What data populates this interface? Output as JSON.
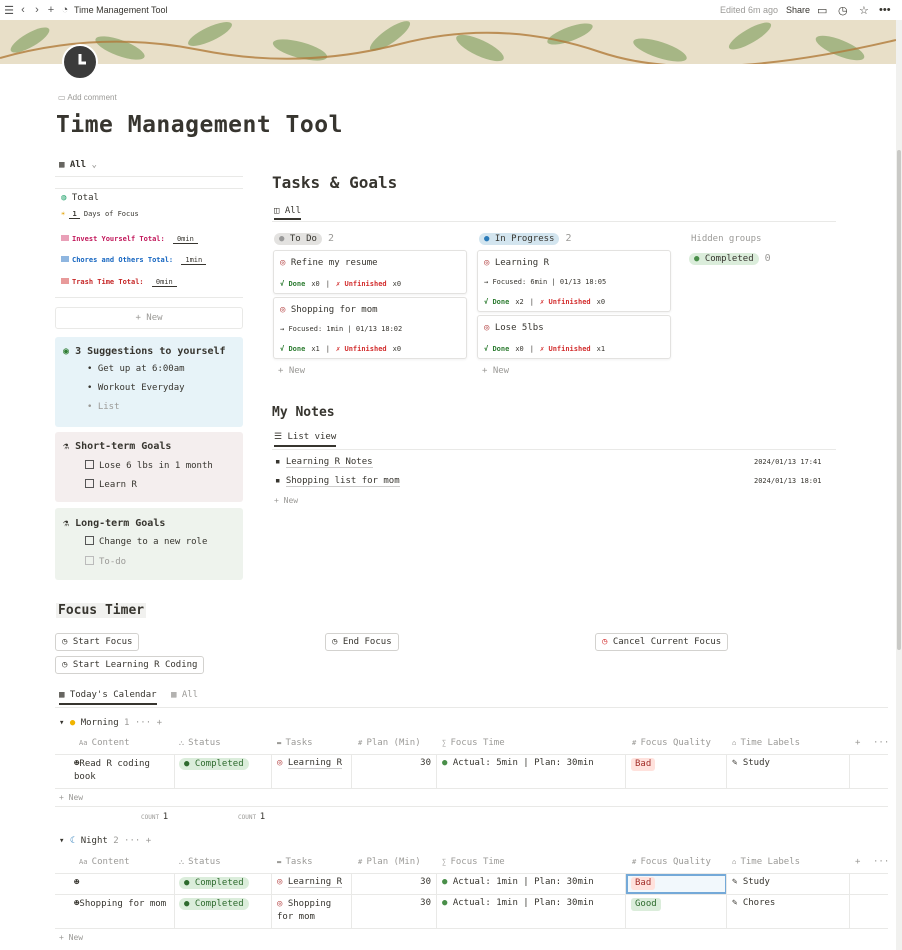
{
  "topbar": {
    "title": "Time Management Tool",
    "edited": "Edited 6m ago",
    "share": "Share"
  },
  "page": {
    "add_comment": "Add comment",
    "title": "Time Management Tool"
  },
  "sidebar_view": {
    "tab": "All"
  },
  "totals": {
    "total": "Total",
    "days_num": "1",
    "days_label": "Days of Focus",
    "invest_label": "Invest Yourself Total:",
    "invest_value": "0min",
    "chores_label": "Chores and Others Total:",
    "chores_value": "1min",
    "trash_label": "Trash Time Total:",
    "trash_value": "0min",
    "new": "+ New"
  },
  "suggestions": {
    "title": "3 Suggestions to yourself",
    "items": [
      "Get up at 6:00am",
      "Workout Everyday",
      "List"
    ]
  },
  "short_goals": {
    "title": "Short-term Goals",
    "items": [
      "Lose 6 lbs in 1 month",
      "Learn R"
    ]
  },
  "long_goals": {
    "title": "Long-term Goals",
    "items": [
      "Change to a new role",
      "To-do"
    ]
  },
  "tasks": {
    "title": "Tasks & Goals",
    "tab": "All",
    "todo": {
      "label": "To Do",
      "count": "2"
    },
    "inprogress": {
      "label": "In Progress",
      "count": "2"
    },
    "hidden": "Hidden groups",
    "completed": {
      "label": "Completed",
      "count": "0"
    },
    "new": "+ New",
    "cards": [
      {
        "title": "Refine my resume",
        "focused": "",
        "done": "Done",
        "done_n": "x0",
        "unf": "Unfinished",
        "unf_n": "x0"
      },
      {
        "title": "Shopping for mom",
        "focused": "Focused: 1min | 01/13 18:02",
        "done": "Done",
        "done_n": "x1",
        "unf": "Unfinished",
        "unf_n": "x0"
      },
      {
        "title": "Learning R",
        "focused": "Focused: 6min | 01/13 18:05",
        "done": "Done",
        "done_n": "x2",
        "unf": "Unfinished",
        "unf_n": "x0"
      },
      {
        "title": "Lose 5lbs",
        "focused": "",
        "done": "Done",
        "done_n": "x0",
        "unf": "Unfinished",
        "unf_n": "x1"
      }
    ]
  },
  "notes": {
    "title": "My Notes",
    "tab": "List view",
    "items": [
      {
        "title": "Learning R Notes",
        "date": "2024/01/13 17:41"
      },
      {
        "title": "Shopping list for mom",
        "date": "2024/01/13 18:01"
      }
    ],
    "new": "+ New"
  },
  "timer": {
    "title": "Focus Timer",
    "start": "Start Focus",
    "end": "End Focus",
    "cancel": "Cancel Current Focus",
    "start_r": "Start Learning R Coding"
  },
  "calendar": {
    "tab_today": "Today's Calendar",
    "tab_all": "All",
    "headers": [
      "Content",
      "Status",
      "Tasks",
      "Plan (Min)",
      "Focus Time",
      "Focus Quality",
      "Time Labels"
    ],
    "new": "+ New",
    "count_label": "COUNT",
    "count_value": "1",
    "morning": {
      "label": "Morning",
      "count": "1",
      "rows": [
        {
          "content": "Read R coding book",
          "status": "Completed",
          "task": "Learning R",
          "plan": "30",
          "focus": "Actual: 5min | Plan: 30min",
          "quality": "Bad",
          "label": "Study"
        }
      ]
    },
    "night": {
      "label": "Night",
      "count": "2",
      "rows": [
        {
          "content": "",
          "status": "Completed",
          "task": "Learning R",
          "plan": "30",
          "focus": "Actual: 1min | Plan: 30min",
          "quality": "Bad",
          "label": "Study"
        },
        {
          "content": "Shopping for mom",
          "status": "Completed",
          "task": "Shopping for mom",
          "plan": "30",
          "focus": "Actual: 1min | Plan: 30min",
          "quality": "Good",
          "label": "Chores"
        }
      ]
    }
  },
  "colors": {
    "invest": "#c2185b",
    "chores": "#1565c0",
    "trash": "#c62828",
    "blue_box": "#e7f3f8",
    "red_box": "#f4eeee",
    "green_box": "#eef3ed"
  }
}
